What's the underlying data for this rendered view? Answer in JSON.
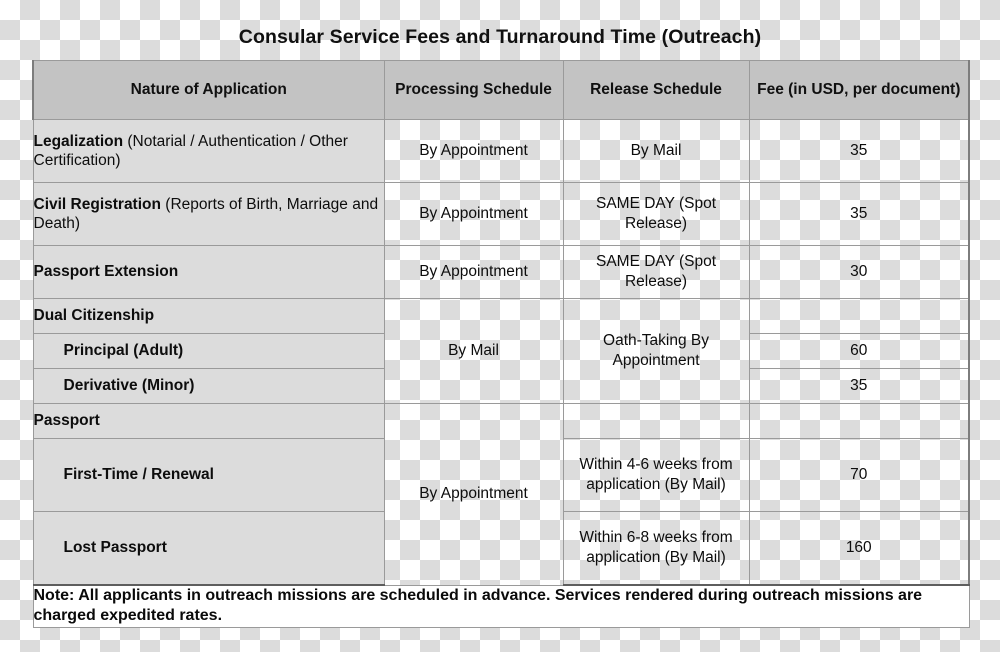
{
  "title": "Consular Service Fees and Turnaround Time (Outreach)",
  "table": {
    "headers": {
      "nature": "Nature of Application",
      "processing": "Processing Schedule",
      "release": "Release Schedule",
      "fee": "Fee  (in USD, per document)"
    },
    "rows": {
      "legalization": {
        "name_bold": "Legalization",
        "name_rest": "(Notarial / Authentication / Other Certification)",
        "processing": "By Appointment",
        "release": "By Mail",
        "fee": "35"
      },
      "civil_registration": {
        "name_bold": "Civil Registration",
        "name_rest": "(Reports of Birth, Marriage and Death)",
        "processing": "By Appointment",
        "release": "SAME DAY (Spot Release)",
        "fee": "35"
      },
      "passport_extension": {
        "name_bold": "Passport Extension",
        "processing": "By Appointment",
        "release": "SAME DAY (Spot Release)",
        "fee": "30"
      },
      "dual_citizenship": {
        "name_bold": "Dual Citizenship",
        "processing": "By Mail",
        "release": "Oath-Taking  By Appointment"
      },
      "principal_adult": {
        "name_bold": "Principal (Adult)",
        "fee": "60"
      },
      "derivative_minor": {
        "name_bold": "Derivative (Minor)",
        "fee": "35"
      },
      "passport": {
        "name_bold": "Passport",
        "processing": "By Appointment"
      },
      "first_time_renewal": {
        "name_bold": "First-Time / Renewal",
        "release": "Within 4-6 weeks from application  (By Mail)",
        "fee": "70"
      },
      "lost_passport": {
        "name_bold": "Lost Passport",
        "release": "Within 6-8 weeks from application  (By Mail)",
        "fee": "160"
      }
    },
    "note": "Note: All applicants in outreach missions are scheduled in advance. Services rendered during outreach missions are charged expedited rates."
  },
  "colors": {
    "header_fill": "#c3c3c3",
    "name_cell_fill": "#dcdcdc",
    "border": "#9a9a9a",
    "outer_border": "#7d7d7d",
    "note_fill": "#ffffff"
  }
}
